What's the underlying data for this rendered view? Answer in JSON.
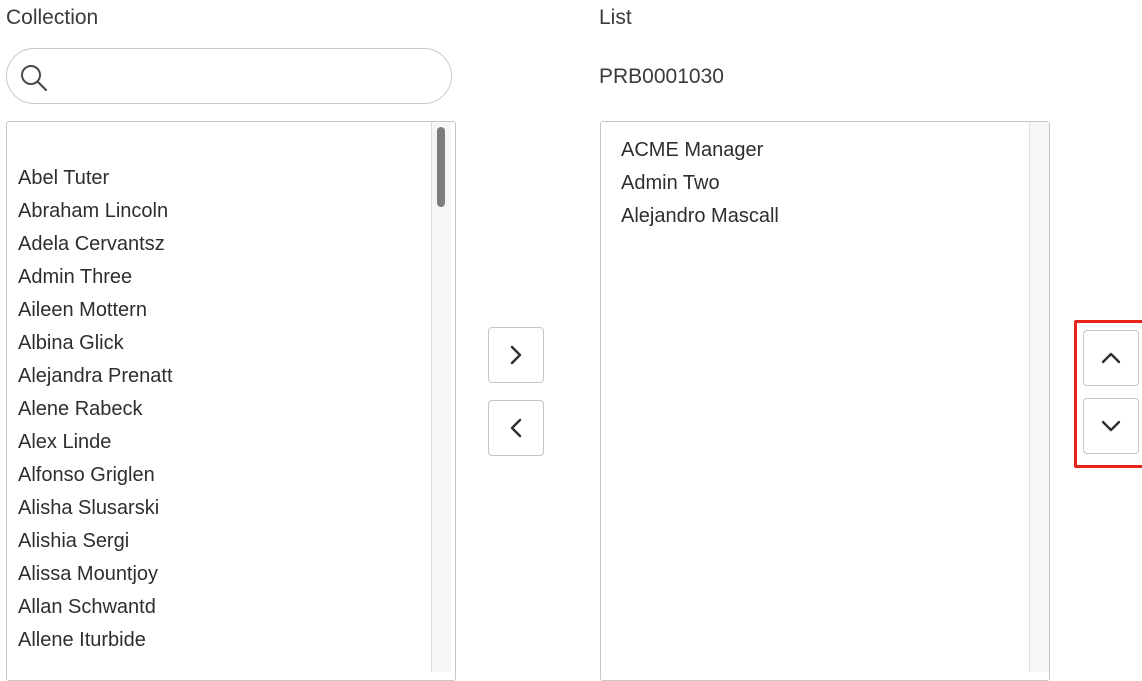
{
  "collection": {
    "title": "Collection",
    "search_placeholder": "",
    "items": [
      "Abel Tuter",
      "Abraham Lincoln",
      "Adela Cervantsz",
      "Admin Three",
      "Aileen Mottern",
      "Albina Glick",
      "Alejandra Prenatt",
      "Alene Rabeck",
      "Alex Linde",
      "Alfonso Griglen",
      "Alisha Slusarski",
      "Alishia Sergi",
      "Alissa Mountjoy",
      "Allan Schwantd",
      "Allene Iturbide"
    ]
  },
  "list": {
    "title": "List",
    "record_id": "PRB0001030",
    "items": [
      "ACME Manager",
      "Admin Two",
      "Alejandro Mascall"
    ]
  },
  "controls": {
    "add_icon": "chevron-right-icon",
    "remove_icon": "chevron-left-icon",
    "up_icon": "chevron-up-icon",
    "down_icon": "chevron-down-icon",
    "highlight_color": "#e8231c"
  }
}
